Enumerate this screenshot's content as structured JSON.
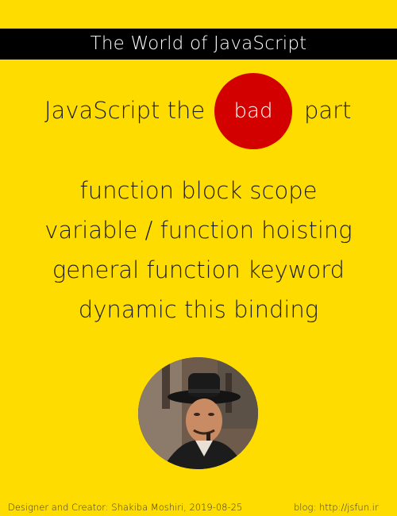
{
  "header": {
    "title": "The World of JavaScript"
  },
  "subtitle": {
    "before": "JavaScript the",
    "highlight": "bad",
    "after": "part"
  },
  "features": [
    "function block scope",
    "variable / function hoisting",
    "general function keyword",
    "dynamic this binding"
  ],
  "footer": {
    "credit": "Designer and Creator: Shakiba Moshiri, 2019-08-25",
    "blog": "blog: http://jsfun.ir"
  },
  "colors": {
    "background": "#ffdc00",
    "title_bar": "#000000",
    "highlight_circle": "#d30000"
  }
}
